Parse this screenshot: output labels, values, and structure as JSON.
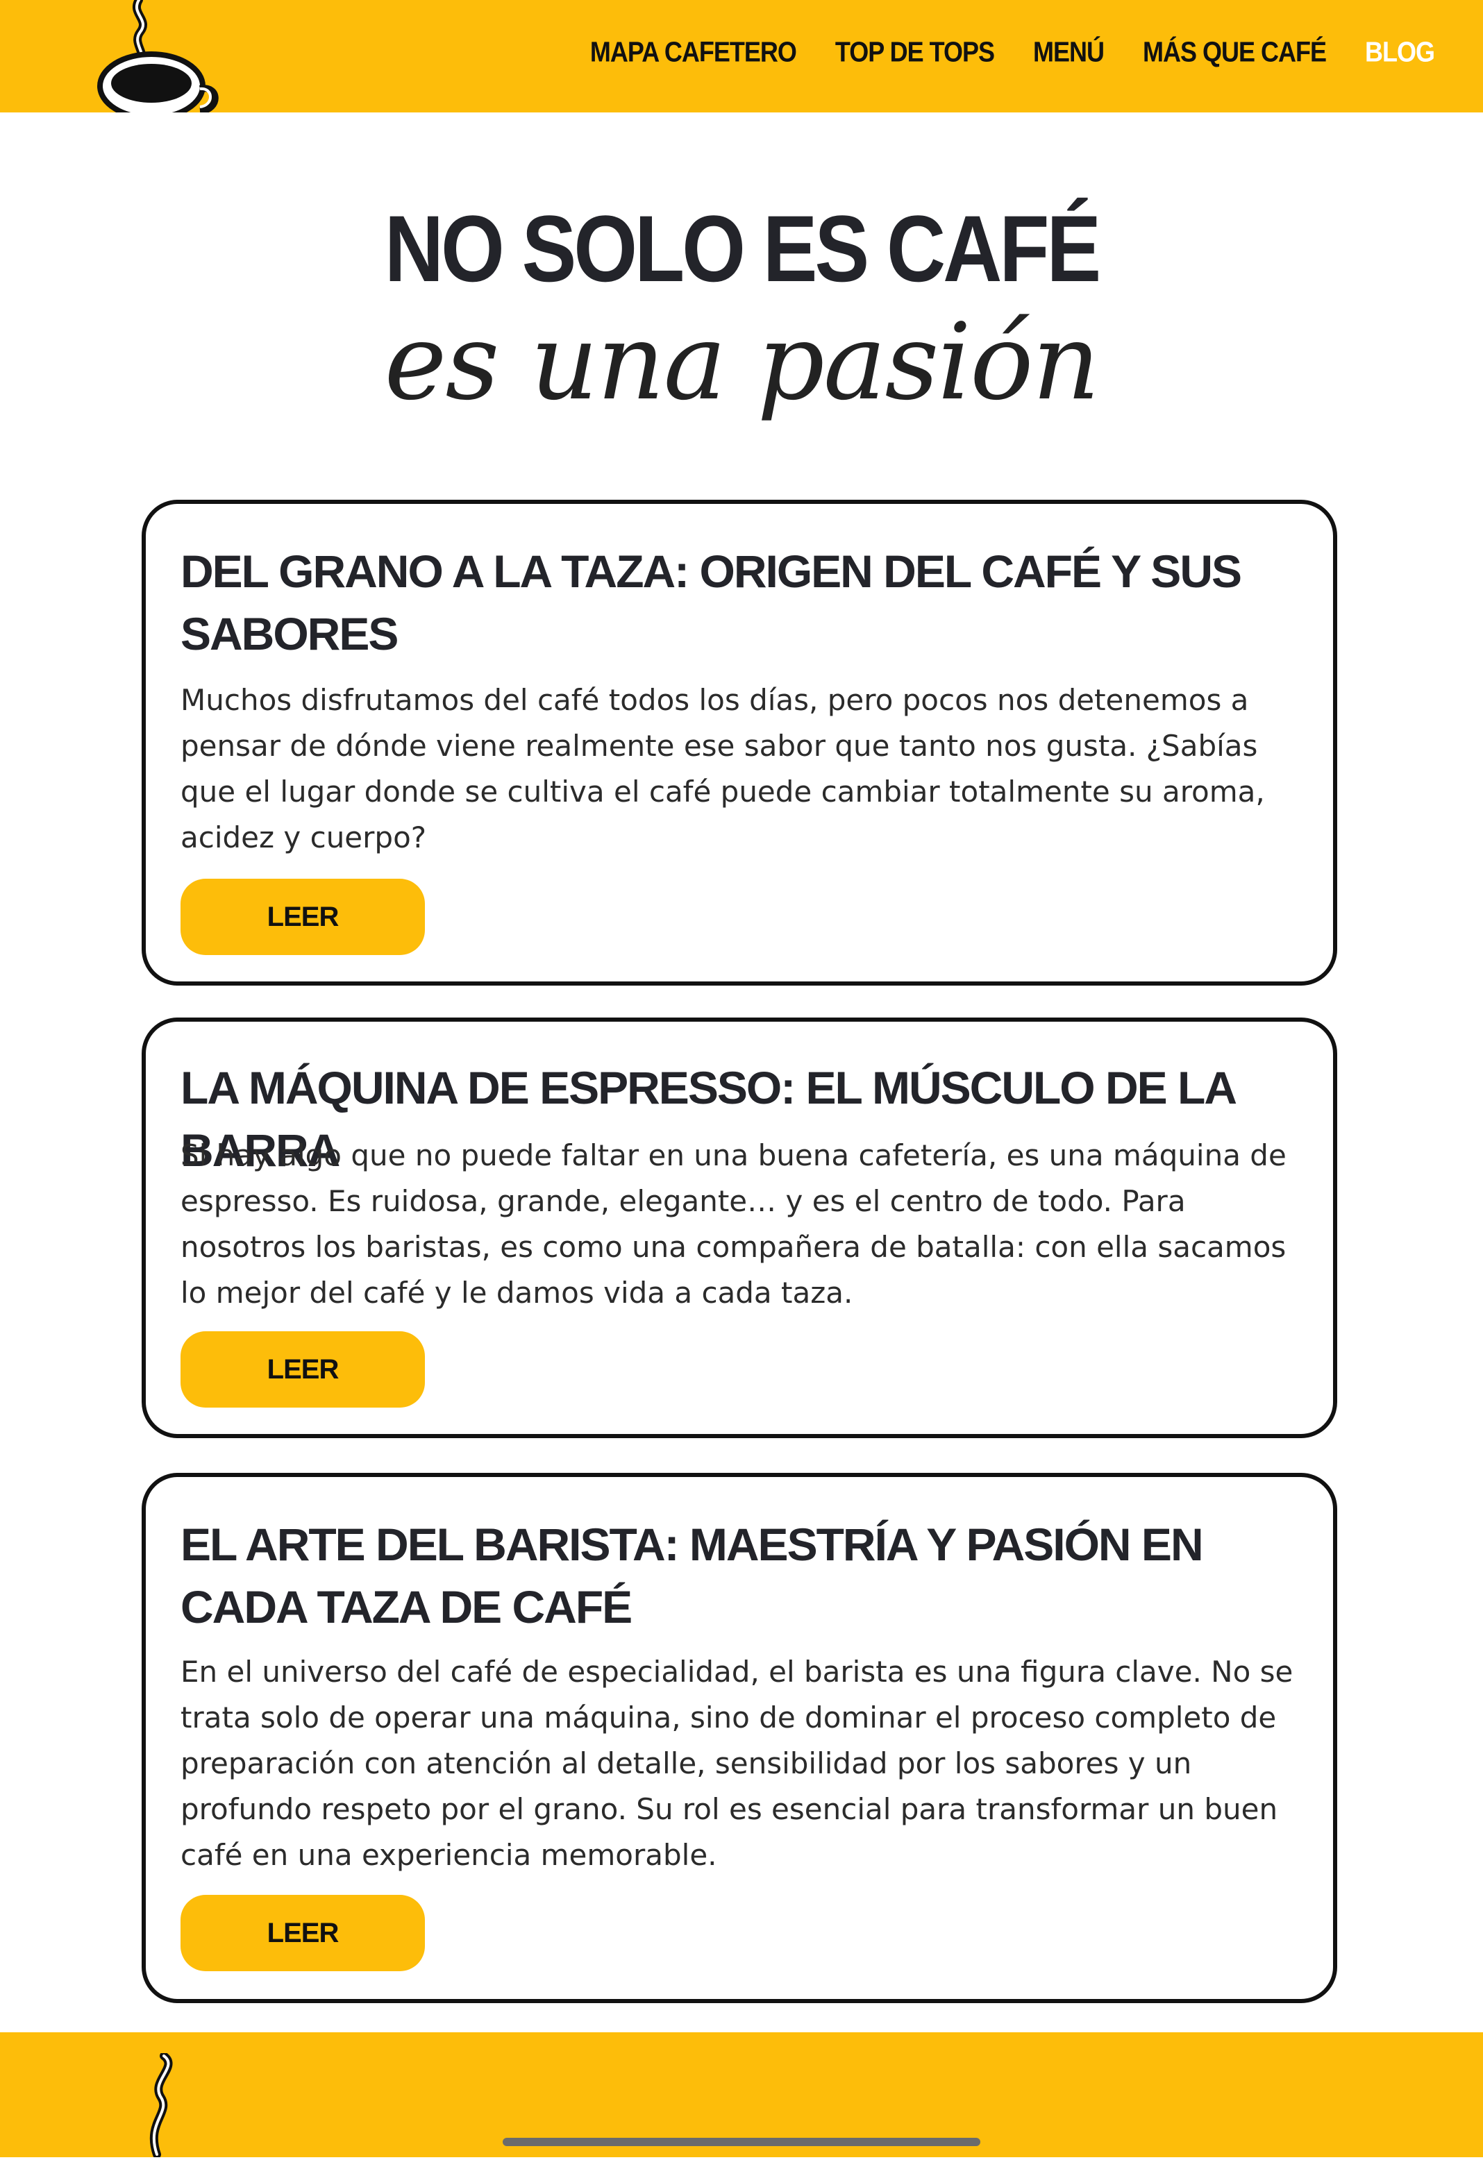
{
  "header": {
    "nav": [
      "MAPA CAFETERO",
      "TOP DE TOPS",
      "MENÚ",
      "MÁS QUE CAFÉ",
      "BLOG"
    ],
    "active_item": "BLOG",
    "logo_icon": "coffee-cup-icon"
  },
  "hero": {
    "title": "NO SOLO ES CAFÉ",
    "subtitle": "es una pasión"
  },
  "posts": [
    {
      "title": "DEL GRANO A LA TAZA: ORIGEN DEL CAFÉ Y SUS SABORES",
      "excerpt": "Muchos disfrutamos del café todos los días, pero pocos nos detenemos a pensar de dónde viene realmente ese sabor que tanto nos gusta. ¿Sabías que el lugar donde se cultiva el café puede cambiar totalmente su aroma, acidez y cuerpo?",
      "button": "LEER"
    },
    {
      "title": "LA MÁQUINA DE ESPRESSO: EL MÚSCULO DE LA BARRA",
      "excerpt": "Si hay algo que no puede faltar en una buena cafetería, es una máquina de espresso. Es ruidosa, grande, elegante… y es el centro de todo. Para nosotros los baristas, es como una compañera de batalla: con ella sacamos lo mejor del café y le damos vida a cada taza.",
      "button": "LEER"
    },
    {
      "title": "EL ARTE DEL BARISTA: MAESTRÍA Y PASIÓN EN CADA TAZA DE CAFÉ",
      "excerpt": "En el universo del café de especialidad, el barista es una figura clave. No se trata solo de operar una máquina, sino de dominar el proceso completo de preparación con atención al detalle, sensibilidad por los sabores y un profundo respeto por el grano. Su rol es esencial para transformar un buen café en una experiencia memorable.",
      "button": "LEER"
    }
  ],
  "footer": {
    "icon": "steam-icon"
  },
  "colors": {
    "brand_yellow": "#fdbd0a",
    "text_dark": "#23242a"
  }
}
